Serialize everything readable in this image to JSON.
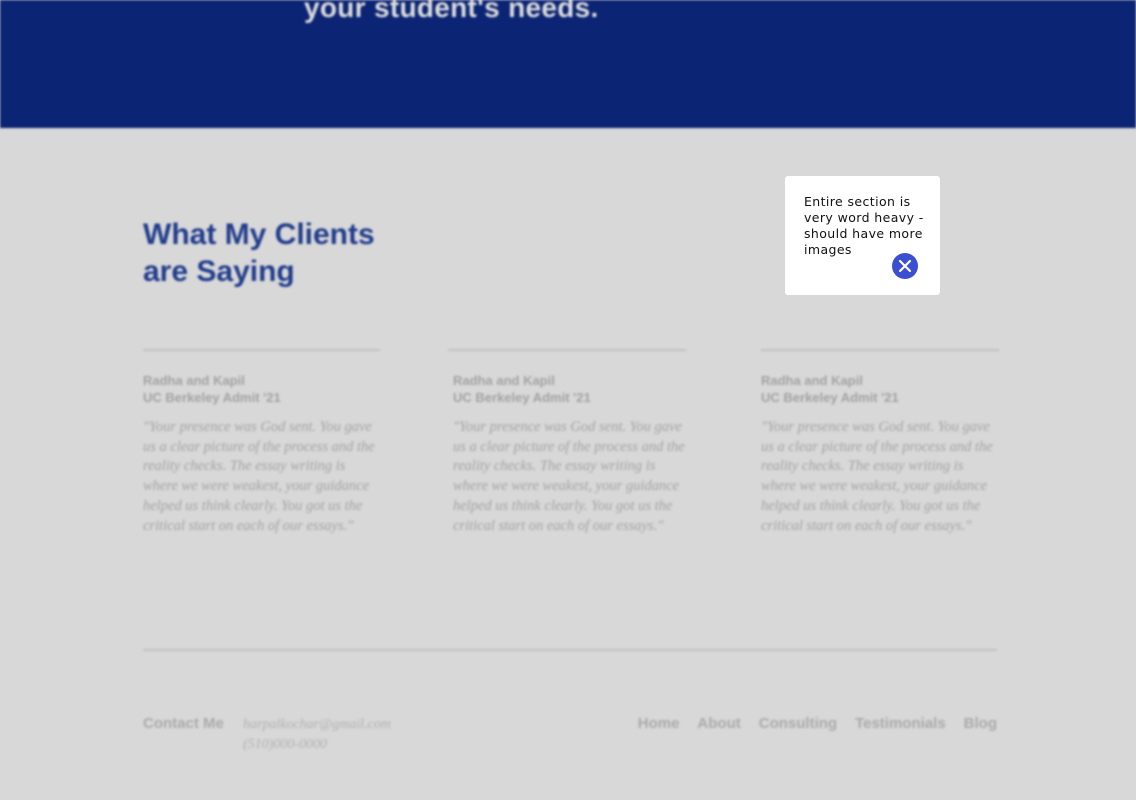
{
  "hero": {
    "text": "your student's needs."
  },
  "testimonials": {
    "title": "What My Clients are Saying",
    "cards": [
      {
        "name": "Radha and Kapil",
        "subtitle": "UC Berkeley Admit '21",
        "quote": "\"Your presence was God sent. You gave us a clear picture of the process and the reality checks. The essay writing is where we were weakest, your guidance helped us think clearly. You got us the critical start on each of our essays.\""
      },
      {
        "name": "Radha and Kapil",
        "subtitle": "UC Berkeley Admit '21",
        "quote": "\"Your presence was God sent. You gave us a clear picture of the process and the reality checks. The essay writing is where we were weakest, your guidance helped us think clearly. You got us the critical start on each of our essays.\""
      },
      {
        "name": "Radha and Kapil",
        "subtitle": "UC Berkeley Admit '21",
        "quote": "\"Your presence was God sent. You gave us a clear picture of the process and the reality checks. The essay writing is where we were weakest, your guidance helped us think clearly. You got us the critical start on each of our essays.\""
      }
    ]
  },
  "footer": {
    "contact_label": "Contact Me",
    "email": "harpalkochar@gmail.com",
    "phone": "(510)000-0000",
    "nav": [
      "Home",
      "About",
      "Consulting",
      "Testimonials",
      "Blog"
    ]
  },
  "comment": {
    "text": "Entire section is very word heavy - should have more images",
    "close_icon": "close-icon"
  },
  "colors": {
    "hero_bg": "#0b2474",
    "title": "#213c8c",
    "page_bg": "#d8d8d8",
    "close_button": "#3b4fd0"
  }
}
